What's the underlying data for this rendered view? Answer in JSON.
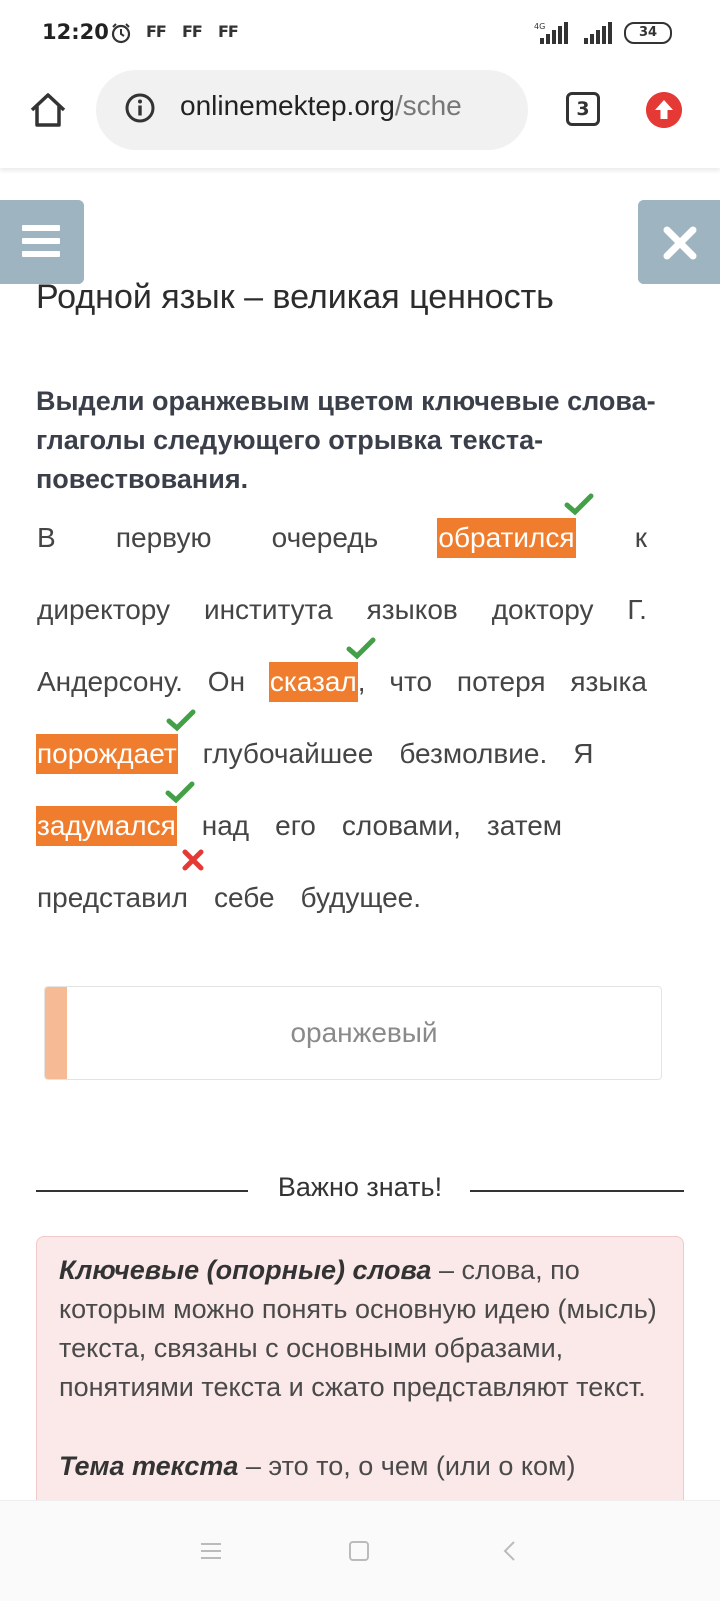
{
  "status_bar": {
    "time": "12:20",
    "indicators": [
      "FF",
      "FF",
      "FF"
    ],
    "battery": "34",
    "network_label": "4G"
  },
  "browser": {
    "url_host": "onlinemektep.org",
    "url_path": "/sche",
    "tab_count": "3"
  },
  "page": {
    "title": "Родной язык – великая ценность",
    "task": "Выдели оранжевым цветом ключевые слова-глаголы следующего отрывка текста-повествования."
  },
  "passage": {
    "lines": [
      {
        "words": [
          {
            "text": "В",
            "highlight": false
          },
          {
            "text": "первую",
            "highlight": false
          },
          {
            "text": "очередь",
            "highlight": false
          },
          {
            "text": "обратился",
            "highlight": true,
            "mark": "check"
          },
          {
            "text": "к",
            "highlight": false
          }
        ]
      },
      {
        "words": [
          {
            "text": "директору",
            "highlight": false
          },
          {
            "text": "института",
            "highlight": false
          },
          {
            "text": "языков",
            "highlight": false
          },
          {
            "text": "доктору",
            "highlight": false
          },
          {
            "text": "Г.",
            "highlight": false
          }
        ]
      },
      {
        "words": [
          {
            "text": "Андерсону.",
            "highlight": false
          },
          {
            "text": "Он",
            "highlight": false
          },
          {
            "text": "сказал",
            "highlight": true,
            "mark": "check",
            "suffix": ","
          },
          {
            "text": "что",
            "highlight": false
          },
          {
            "text": "потеря",
            "highlight": false
          },
          {
            "text": "языка",
            "highlight": false
          }
        ]
      },
      {
        "words": [
          {
            "text": "порождает",
            "highlight": true,
            "mark": "check"
          },
          {
            "text": "глубочайшее",
            "highlight": false
          },
          {
            "text": "безмолвие.",
            "highlight": false
          },
          {
            "text": "Я",
            "highlight": false
          }
        ]
      },
      {
        "words": [
          {
            "text": "задумался",
            "highlight": true,
            "mark": "check"
          },
          {
            "text": "над",
            "highlight": false
          },
          {
            "text": "его",
            "highlight": false
          },
          {
            "text": "словами,",
            "highlight": false
          },
          {
            "text": "затем",
            "highlight": false
          }
        ]
      },
      {
        "words": [
          {
            "text": "представил",
            "highlight": false,
            "mark": "cross"
          },
          {
            "text": "себе",
            "highlight": false
          },
          {
            "text": "будущее.",
            "highlight": false
          }
        ]
      }
    ]
  },
  "answer_option": {
    "label": "оранжевый",
    "color": "#f6bb95"
  },
  "info": {
    "heading": "Важно знать!",
    "term1": "Ключевые (опорные) слова",
    "def1": " – слова, по которым можно понять основную идею (мысль) текста, связаны с основными образами, понятиями текста и сжато представляют текст.",
    "term2": "Тема текста",
    "def2": " – это то, о чем (или о ком)"
  },
  "colors": {
    "highlight": "#ef7d2d",
    "check": "#43a047",
    "cross": "#e53935",
    "floating_buttons": "#9fb4c1"
  },
  "icons": [
    "home-icon",
    "info-icon",
    "tabs-icon",
    "update-icon",
    "menu-icon",
    "close-icon",
    "check-icon",
    "cross-icon",
    "nav-menu-icon",
    "nav-home-icon",
    "nav-back-icon"
  ]
}
